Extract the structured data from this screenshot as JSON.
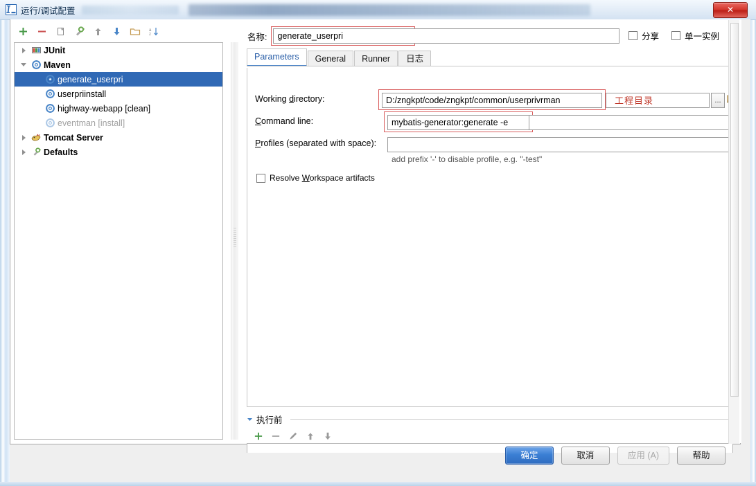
{
  "window": {
    "title": "运行/调试配置",
    "close_label": "✕"
  },
  "tree_toolbar": {
    "buttons": [
      {
        "name": "add-configuration-button",
        "icon": "plus-icon"
      },
      {
        "name": "remove-configuration-button",
        "icon": "minus-icon"
      },
      {
        "name": "copy-configuration-button",
        "icon": "copy-icon"
      },
      {
        "name": "edit-defaults-button",
        "icon": "wrench-icon"
      },
      {
        "name": "move-up-button",
        "icon": "arrow-up-icon"
      },
      {
        "name": "move-down-button",
        "icon": "arrow-down-icon"
      },
      {
        "name": "create-folder-button",
        "icon": "folder-icon"
      },
      {
        "name": "sort-configurations-button",
        "icon": "sort-alpha-icon"
      }
    ]
  },
  "tree": {
    "items": [
      {
        "label": "JUnit",
        "icon": "junit-icon",
        "indent": 0,
        "expander": "collapsed",
        "bold": true,
        "selected": false,
        "dimmed": false
      },
      {
        "label": "Maven",
        "icon": "maven-icon",
        "indent": 0,
        "expander": "expanded",
        "bold": true,
        "selected": false,
        "dimmed": false
      },
      {
        "label": "generate_userpri",
        "icon": "maven-icon",
        "indent": 1,
        "expander": "none",
        "bold": false,
        "selected": true,
        "dimmed": false
      },
      {
        "label": "userpriinstall",
        "icon": "maven-icon",
        "indent": 1,
        "expander": "none",
        "bold": false,
        "selected": false,
        "dimmed": false
      },
      {
        "label": "highway-webapp [clean]",
        "icon": "maven-icon",
        "indent": 1,
        "expander": "none",
        "bold": false,
        "selected": false,
        "dimmed": false
      },
      {
        "label": "eventman [install]",
        "icon": "maven-icon",
        "indent": 1,
        "expander": "none",
        "bold": false,
        "selected": false,
        "dimmed": true
      },
      {
        "label": "Tomcat Server",
        "icon": "tomcat-icon",
        "indent": 0,
        "expander": "collapsed",
        "bold": true,
        "selected": false,
        "dimmed": false
      },
      {
        "label": "Defaults",
        "icon": "wrench-icon",
        "indent": 0,
        "expander": "collapsed",
        "bold": true,
        "selected": false,
        "dimmed": false
      }
    ]
  },
  "editor": {
    "name_label": "名称:",
    "name_value": "generate_userpri",
    "share_checkbox": "分享",
    "single_instance_checkbox": "单一实例",
    "tabs": [
      {
        "label": "Parameters",
        "active": true
      },
      {
        "label": "General",
        "active": false
      },
      {
        "label": "Runner",
        "active": false
      },
      {
        "label": "日志",
        "active": false
      }
    ],
    "working_directory_label": "Working directory:",
    "working_directory_value": "D:/zngkpt/code/zngkpt/common/userprivrman",
    "working_directory_annotation": "工程目录",
    "browse_button_label": "...",
    "command_line_label": "Command line:",
    "command_line_value": "mybatis-generator:generate -e",
    "profiles_label": "Profiles (separated with space):",
    "profiles_value": "",
    "profiles_hint": "add prefix '-' to disable profile, e.g. \"-test\"",
    "resolve_workspace_label": "Resolve Workspace artifacts"
  },
  "before_launch": {
    "title": "执行前",
    "buttons": [
      {
        "name": "before-launch-add-button",
        "icon": "plus-icon"
      },
      {
        "name": "before-launch-remove-button",
        "icon": "minus-icon"
      },
      {
        "name": "before-launch-edit-button",
        "icon": "pencil-icon"
      },
      {
        "name": "before-launch-up-button",
        "icon": "arrow-up-icon"
      },
      {
        "name": "before-launch-down-button",
        "icon": "arrow-down-icon"
      }
    ]
  },
  "footer": {
    "ok": "确定",
    "cancel": "取消",
    "apply": "应用 (A)",
    "help": "帮助"
  },
  "colors": {
    "accent_blue": "#3069b5",
    "annotation_red": "#c0392b",
    "highlight_box": "#d95c5c"
  }
}
